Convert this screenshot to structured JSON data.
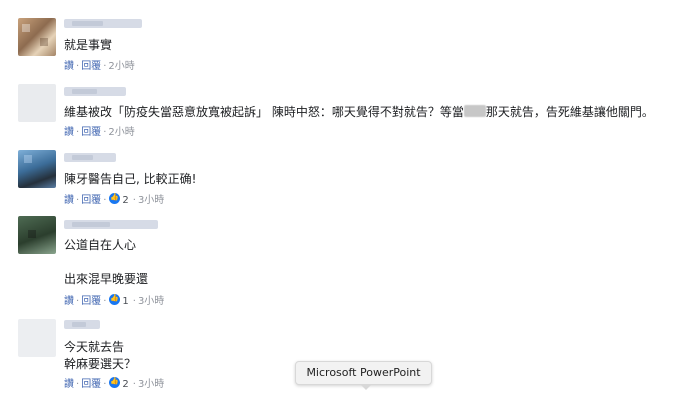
{
  "comments": [
    {
      "text": "就是事實",
      "meta": {
        "like": "讚",
        "reply": "回覆",
        "time": "2小時"
      }
    },
    {
      "text_before": "維基被改「防疫失當惡意放寬被起訴」 陳時中怒：哪天覺得不對就告？等當",
      "text_after": "那天就告，告死維基讓他關門。",
      "meta": {
        "like": "讚",
        "reply": "回覆",
        "time": "2小時"
      }
    },
    {
      "text": "陳牙醫告自己, 比較正确!",
      "meta": {
        "like": "讚",
        "reply": "回覆",
        "reactions": "2",
        "time": "3小時"
      }
    },
    {
      "text": "公道自在人心",
      "text2": "出來混早晚要還",
      "meta": {
        "like": "讚",
        "reply": "回覆",
        "reactions": "1",
        "time": "3小時"
      }
    },
    {
      "text": "今天就去告",
      "text2": "幹麻要選天？",
      "meta": {
        "like": "讚",
        "reply": "回覆",
        "reactions": "2",
        "time": "3小時"
      }
    }
  ],
  "tooltip": {
    "label": "Microsoft PowerPoint"
  },
  "colors": {
    "link": "#4267b2",
    "meta": "#90949c",
    "reaction": "#1877f2"
  }
}
